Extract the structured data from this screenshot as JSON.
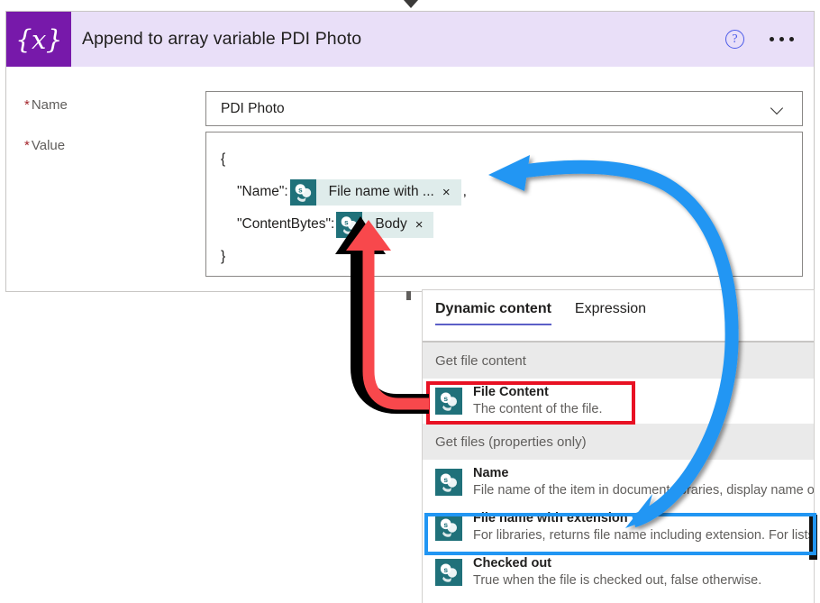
{
  "card": {
    "icon_glyph": "{x}",
    "title": "Append to array variable PDI Photo",
    "help_label": "?",
    "accent_color": "#7719aa",
    "header_bg": "#e9dff8"
  },
  "form": {
    "name": {
      "label": "Name",
      "required_mark": "*",
      "value": "PDI Photo"
    },
    "value": {
      "label": "Value",
      "required_mark": "*",
      "line_open": "{",
      "line_close": "}",
      "name_key": "\"Name\":",
      "name_comma": ",",
      "contentbytes_key": "\"ContentBytes\":",
      "tokens": [
        {
          "label": "File name with ...",
          "close": "×",
          "icon": "sharepoint-icon"
        },
        {
          "label": "Body",
          "close": "×",
          "icon": "sharepoint-icon"
        }
      ]
    }
  },
  "dynamic_content": {
    "tabs": [
      {
        "label": "Dynamic content",
        "active": true
      },
      {
        "label": "Expression",
        "active": false
      }
    ],
    "groups": [
      {
        "header": "Get file content",
        "items": [
          {
            "title": "File Content",
            "desc": "The content of the file.",
            "icon": "sharepoint-icon",
            "highlight": "red"
          }
        ]
      },
      {
        "header": "Get files (properties only)",
        "items": [
          {
            "title": "Name",
            "desc": "File name of the item in document libraries, display name of ...",
            "icon": "sharepoint-icon",
            "highlight": "none"
          },
          {
            "title": "File name with extension",
            "desc": "For libraries, returns file name including extension. For lists, r...",
            "icon": "sharepoint-icon",
            "highlight": "blue"
          },
          {
            "title": "Checked out",
            "desc": "True when the file is checked out, false otherwise.",
            "icon": "sharepoint-icon",
            "highlight": "none"
          }
        ]
      }
    ]
  },
  "annotations": {
    "blue_arrow": {
      "color": "#2196f3",
      "from": "File name with extension list item",
      "to": "File name with ... token"
    },
    "red_arrow": {
      "color": "#f8484c",
      "outline": "#000000",
      "from": "File Content list item",
      "to": "Body token"
    }
  },
  "colors": {
    "sharepoint_teal": "#20717a",
    "token_bg": "#dfeceb",
    "group_bg": "#eaeaea",
    "tab_underline": "#5b5fc7",
    "required": "#a4262c"
  }
}
